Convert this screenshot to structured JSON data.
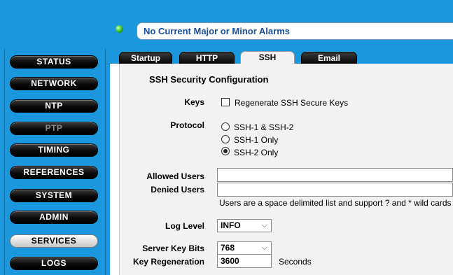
{
  "alarm": {
    "text": "No Current Major or Minor Alarms",
    "led_color": "#3fcf2e"
  },
  "sidebar": {
    "items": [
      {
        "label": "STATUS",
        "state": "normal"
      },
      {
        "label": "NETWORK",
        "state": "normal"
      },
      {
        "label": "NTP",
        "state": "normal"
      },
      {
        "label": "PTP",
        "state": "disabled"
      },
      {
        "label": "TIMING",
        "state": "normal"
      },
      {
        "label": "REFERENCES",
        "state": "normal"
      },
      {
        "label": "SYSTEM",
        "state": "normal"
      },
      {
        "label": "ADMIN",
        "state": "normal"
      },
      {
        "label": "SERVICES",
        "state": "active"
      },
      {
        "label": "LOGS",
        "state": "normal"
      }
    ]
  },
  "tabs": [
    {
      "label": "Startup"
    },
    {
      "label": "HTTP"
    },
    {
      "label": "SSH",
      "active": true
    },
    {
      "label": "Email"
    }
  ],
  "form": {
    "title": "SSH Security Configuration",
    "keys": {
      "label": "Keys",
      "option": "Regenerate SSH Secure Keys",
      "checked": false
    },
    "protocol": {
      "label": "Protocol",
      "options": [
        "SSH-1 & SSH-2",
        "SSH-1 Only",
        "SSH-2 Only"
      ],
      "selected": "SSH-2 Only"
    },
    "allowed_users": {
      "label": "Allowed Users",
      "value": ""
    },
    "denied_users": {
      "label": "Denied Users",
      "value": ""
    },
    "users_hint": "Users are a space delimited list and support ? and * wild cards",
    "log_level": {
      "label": "Log Level",
      "value": "INFO"
    },
    "server_key_bits": {
      "label": "Server Key Bits",
      "value": "768"
    },
    "key_regeneration": {
      "label": "Key Regeneration",
      "value": "3600",
      "unit": "Seconds"
    }
  },
  "colors": {
    "brand_blue": "#1a97dd",
    "alarm_text": "#1c4f9c",
    "panel_bg": "#f2f2f2"
  }
}
